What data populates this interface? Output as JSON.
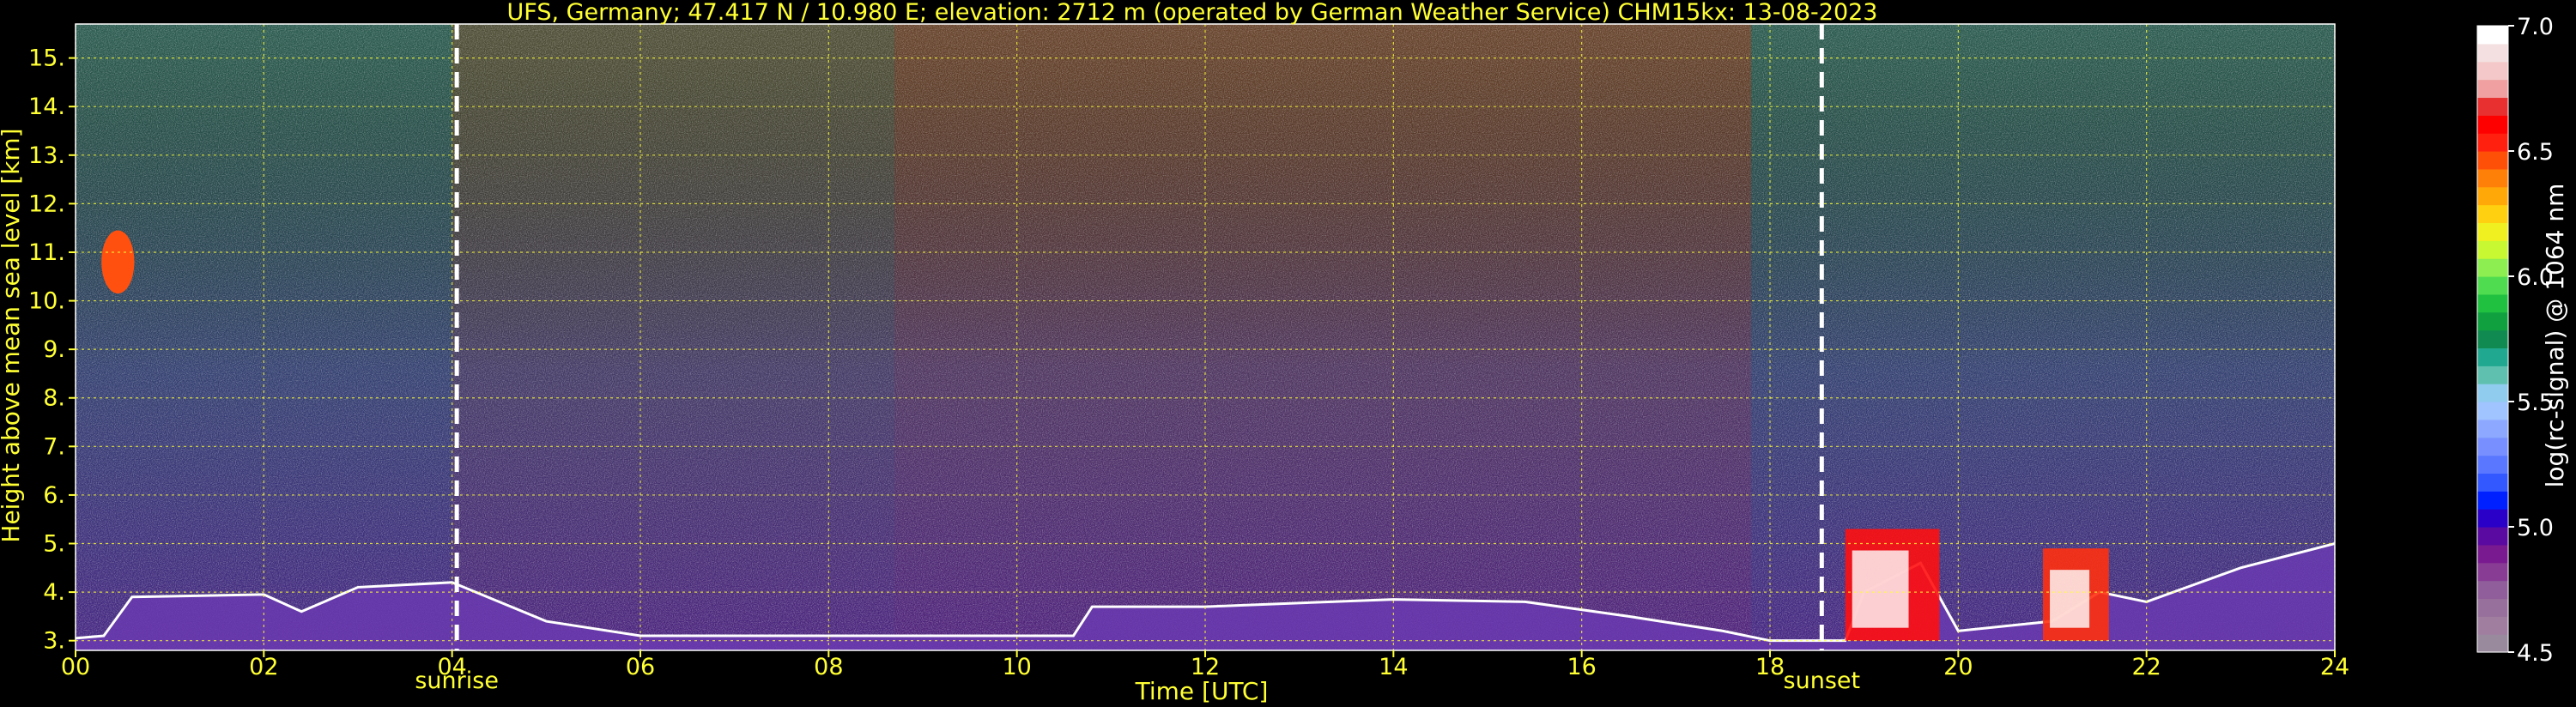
{
  "chart_data": {
    "type": "heatmap",
    "title": "UFS, Germany; 47.417 N / 10.980 E; elevation: 2712 m  (operated by German Weather Service)    CHM15kx: 13-08-2023",
    "xlabel": "Time [UTC]",
    "ylabel": "Height above mean sea level [km]",
    "xlim": [
      0,
      24
    ],
    "ylim": [
      2.8,
      15.7
    ],
    "x_ticks": [
      0,
      2,
      4,
      6,
      8,
      10,
      12,
      14,
      16,
      18,
      20,
      22,
      24
    ],
    "x_tick_labels": [
      "00",
      "02",
      "04",
      "06",
      "08",
      "10",
      "12",
      "14",
      "16",
      "18",
      "20",
      "22",
      "24"
    ],
    "y_ticks": [
      3,
      4,
      5,
      6,
      7,
      8,
      9,
      10,
      11,
      12,
      13,
      14,
      15
    ],
    "y_tick_labels": [
      "3.",
      "4.",
      "5.",
      "6.",
      "7.",
      "8.",
      "9.",
      "10.",
      "11.",
      "12.",
      "13.",
      "14.",
      "15."
    ],
    "grid": true,
    "markers": [
      {
        "label": "sunrise",
        "x": 4.05
      },
      {
        "label": "sunset",
        "x": 18.55
      }
    ],
    "colorbar": {
      "label": "log(rc-signal) @ 1064 nm",
      "range": [
        4.5,
        7.0
      ],
      "ticks": [
        4.5,
        5.0,
        5.5,
        6.0,
        6.5,
        7.0
      ],
      "tick_labels": [
        "4.5",
        "5.0",
        "5.5",
        "6.0",
        "6.5",
        "7.0"
      ],
      "colors": [
        "#9a8a9e",
        "#a07ea0",
        "#98709c",
        "#905e9a",
        "#883c94",
        "#7a1a90",
        "#5a0aa0",
        "#2a00c8",
        "#0020ff",
        "#3458ff",
        "#5a78ff",
        "#7890ff",
        "#8ca8ff",
        "#a0c4ff",
        "#90ccee",
        "#60c0b0",
        "#20a890",
        "#108a50",
        "#10a040",
        "#20c040",
        "#50dc50",
        "#8cee50",
        "#c8f832",
        "#f0f020",
        "#ffd010",
        "#ffa808",
        "#ff8008",
        "#ff5008",
        "#ff2010",
        "#ff0000",
        "#e83030",
        "#f0a0a0",
        "#f4c8c8",
        "#f4e0e0",
        "#ffffff"
      ]
    },
    "background_layers": [
      {
        "x_start": 0,
        "x_end": 4.0,
        "color": "#3a7a6a"
      },
      {
        "x_start": 4.0,
        "x_end": 8.7,
        "color": "#6a6a4a"
      },
      {
        "x_start": 8.7,
        "x_end": 17.8,
        "color": "#8a5a3a"
      },
      {
        "x_start": 17.8,
        "x_end": 24,
        "color": "#3a7a6a"
      }
    ],
    "features": [
      {
        "kind": "boundary_layer",
        "points": [
          [
            0,
            3.05
          ],
          [
            0.3,
            3.1
          ],
          [
            0.6,
            3.9
          ],
          [
            2.0,
            3.95
          ],
          [
            2.4,
            3.6
          ],
          [
            3.0,
            4.1
          ],
          [
            4.0,
            4.2
          ],
          [
            5.0,
            3.4
          ],
          [
            6.0,
            3.1
          ],
          [
            8.0,
            3.1
          ],
          [
            9.0,
            3.1
          ],
          [
            10.6,
            3.1
          ],
          [
            10.8,
            3.7
          ],
          [
            12.0,
            3.7
          ],
          [
            14.0,
            3.85
          ],
          [
            15.4,
            3.8
          ],
          [
            16.5,
            3.5
          ],
          [
            17.5,
            3.2
          ],
          [
            18.0,
            3.0
          ],
          [
            18.8,
            3.0
          ],
          [
            19.0,
            4.0
          ],
          [
            19.6,
            4.6
          ],
          [
            20.0,
            3.2
          ],
          [
            21.0,
            3.4
          ],
          [
            21.5,
            4.0
          ],
          [
            22.0,
            3.8
          ],
          [
            23.0,
            4.5
          ],
          [
            24,
            5.0
          ]
        ],
        "color": "#ffffff"
      },
      {
        "kind": "cirrus_cloud",
        "x": 0.45,
        "y": 10.8,
        "width_h": 0.35,
        "height_km": 1.3,
        "color": "#ff5010"
      },
      {
        "kind": "low_cloud",
        "x_start": 18.8,
        "x_end": 19.8,
        "y_top": 5.3,
        "color": "#ff1010"
      },
      {
        "kind": "low_cloud",
        "x_start": 20.9,
        "x_end": 21.6,
        "y_top": 4.9,
        "color": "#ff3010"
      }
    ]
  }
}
